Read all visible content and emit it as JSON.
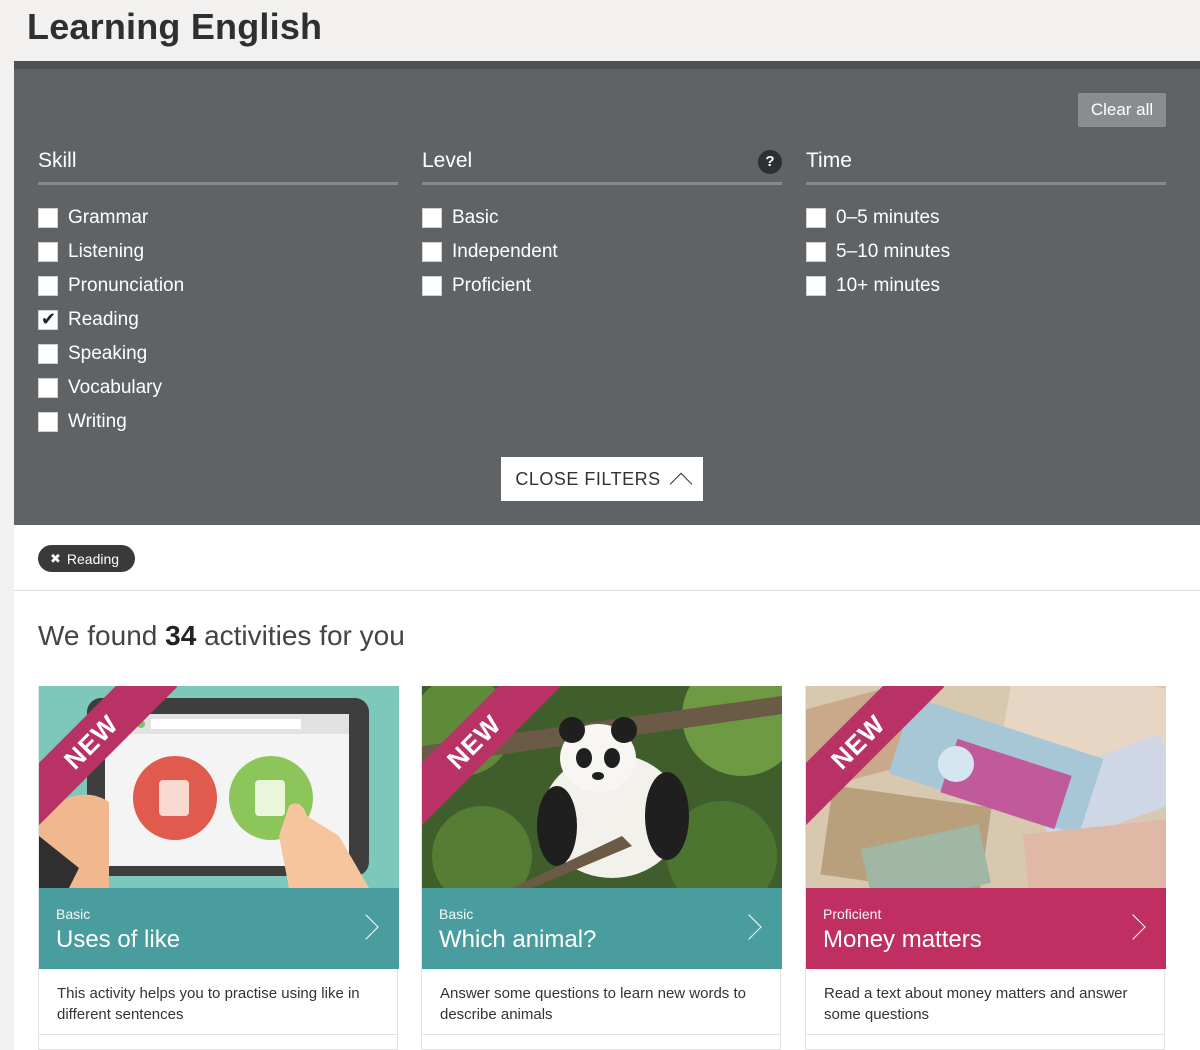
{
  "page": {
    "title": "Learning English"
  },
  "filters": {
    "clear_all": "Clear all",
    "close_label": "CLOSE FILTERS",
    "skill": {
      "heading": "Skill",
      "options": [
        {
          "label": "Grammar",
          "checked": false
        },
        {
          "label": "Listening",
          "checked": false
        },
        {
          "label": "Pronunciation",
          "checked": false
        },
        {
          "label": "Reading",
          "checked": true
        },
        {
          "label": "Speaking",
          "checked": false
        },
        {
          "label": "Vocabulary",
          "checked": false
        },
        {
          "label": "Writing",
          "checked": false
        }
      ]
    },
    "level": {
      "heading": "Level",
      "help": "?",
      "options": [
        {
          "label": "Basic",
          "checked": false
        },
        {
          "label": "Independent",
          "checked": false
        },
        {
          "label": "Proficient",
          "checked": false
        }
      ]
    },
    "time": {
      "heading": "Time",
      "options": [
        {
          "label": "0–5 minutes",
          "checked": false
        },
        {
          "label": "5–10 minutes",
          "checked": false
        },
        {
          "label": "10+ minutes",
          "checked": false
        }
      ]
    }
  },
  "active_filter": {
    "x": "✖",
    "label": "Reading"
  },
  "results": {
    "prefix": "We found",
    "count": "34",
    "suffix": "activities for you"
  },
  "cards": [
    {
      "badge": "NEW",
      "level": "Basic",
      "title": "Uses of like",
      "description": "This activity helps you to practise using like in different sentences",
      "color": "#4a9d9f"
    },
    {
      "badge": "NEW",
      "level": "Basic",
      "title": "Which animal?",
      "description": "Answer some questions to learn new words to describe animals",
      "color": "#4a9d9f"
    },
    {
      "badge": "NEW",
      "level": "Proficient",
      "title": "Money matters",
      "description": "Read a text about money matters and answer some questions",
      "color": "#bf2f61"
    }
  ]
}
